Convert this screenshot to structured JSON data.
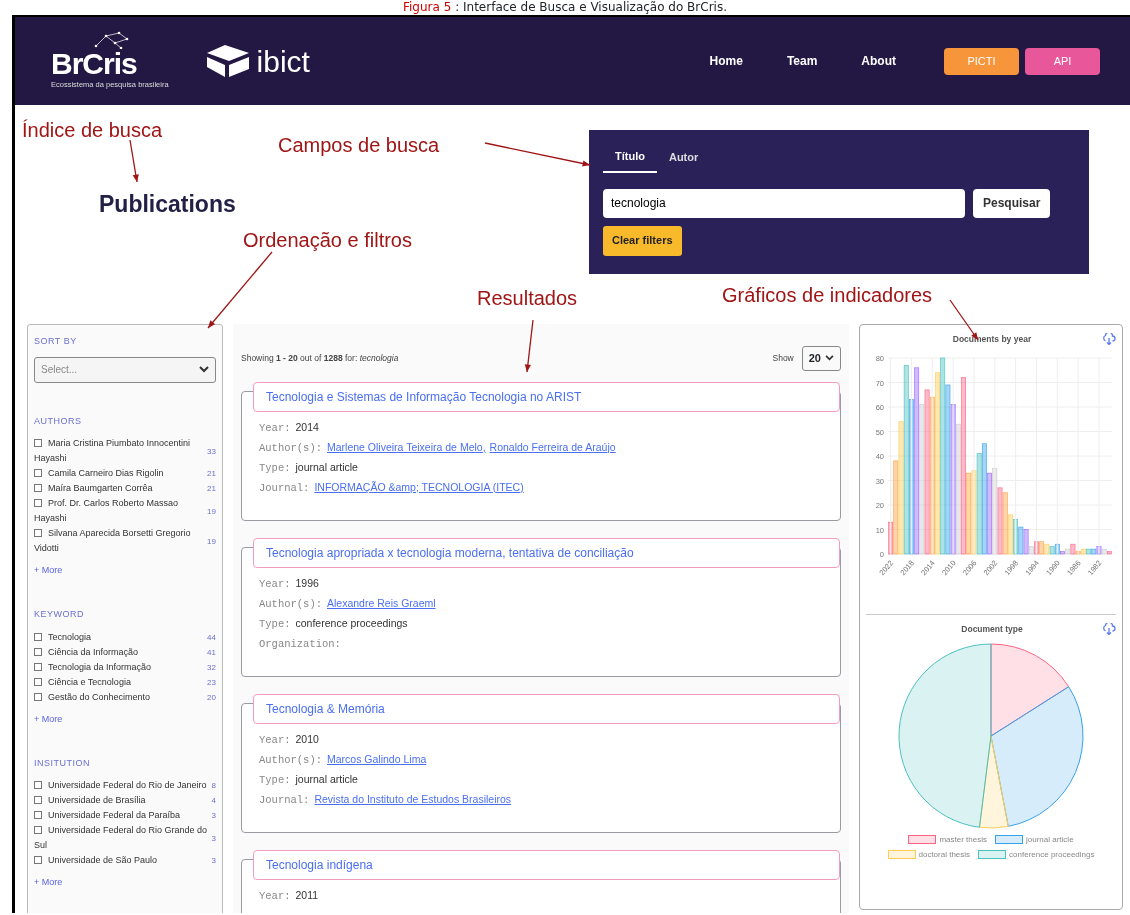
{
  "caption": {
    "label": "Figura 5",
    "text": ": Interface de Busca e Visualização do BrCris."
  },
  "navbar": {
    "logo": "BrCris",
    "logo_subtitle": "Ecossistema da pesquisa brasileira",
    "partner": "ibict",
    "links": [
      "Home",
      "Team",
      "About"
    ],
    "buttons": [
      {
        "label": "PICTI",
        "kind": "orange"
      },
      {
        "label": "API",
        "kind": "pink"
      }
    ]
  },
  "annotations": [
    "Índice de busca",
    "Campos de busca",
    "Ordenação e filtros",
    "Resultados",
    "Gráficos de indicadores"
  ],
  "heading": "Publications",
  "search": {
    "tabs": [
      {
        "label": "Título",
        "selected": true
      },
      {
        "label": "Autor",
        "selected": false
      }
    ],
    "value": "tecnologia",
    "button": "Pesquisar",
    "clear": "Clear filters"
  },
  "sidebar": {
    "sort_label": "SORT BY",
    "sort_placeholder": "Select...",
    "facets": [
      {
        "title": "AUTHORS",
        "more": "+ More",
        "items": [
          {
            "label": "Maria Cristina Piumbato Innocentini Hayashi",
            "count": "33",
            "checked": false
          },
          {
            "label": "Camila Carneiro Dias Rigolin",
            "count": "21",
            "checked": false
          },
          {
            "label": "Maíra Baumgarten Corrêa",
            "count": "21",
            "checked": false
          },
          {
            "label": "Prof. Dr. Carlos Roberto Massao Hayashi",
            "count": "19",
            "checked": false
          },
          {
            "label": "Silvana Aparecida Borsetti Gregorio Vidotti",
            "count": "19",
            "checked": false
          }
        ]
      },
      {
        "title": "KEYWORD",
        "more": "+ More",
        "items": [
          {
            "label": "Tecnologia",
            "count": "44",
            "checked": false
          },
          {
            "label": "Ciência da Informação",
            "count": "41",
            "checked": false
          },
          {
            "label": "Tecnologia da Informação",
            "count": "32",
            "checked": false
          },
          {
            "label": "Ciência e Tecnologia",
            "count": "23",
            "checked": false
          },
          {
            "label": "Gestão do Conhecimento",
            "count": "20",
            "checked": false
          }
        ]
      },
      {
        "title": "INSITUTION",
        "more": "+ More",
        "items": [
          {
            "label": "Universidade Federal do Rio de Janeiro",
            "count": "8",
            "checked": false
          },
          {
            "label": "Universidade de Brasília",
            "count": "4",
            "checked": false
          },
          {
            "label": "Universidade Federal da Paraíba",
            "count": "3",
            "checked": false
          },
          {
            "label": "Universidade Federal do Rio Grande do Sul",
            "count": "3",
            "checked": false
          },
          {
            "label": "Universidade de São Paulo",
            "count": "3",
            "checked": false
          }
        ]
      }
    ]
  },
  "results": {
    "summary": "Showing **1 - 20** out of **1288** for: *tecnologia*",
    "show_label": "Show",
    "page_size": "20",
    "items": [
      {
        "title": "Tecnologia e Sistemas de Informação Tecnologia no ARIST",
        "fields": [
          {
            "label": "Year:",
            "kind": "text",
            "value": "2014"
          },
          {
            "label": "Author(s):",
            "kind": "links",
            "links": [
              "Marlene Oliveira Teixeira de Melo,",
              "Ronaldo Ferreira de Araújo"
            ]
          },
          {
            "label": "Type:",
            "kind": "text",
            "value": "journal article"
          },
          {
            "label": "Journal:",
            "kind": "links",
            "links": [
              "INFORMAÇÃO &amp; TECNOLOGIA (ITEC)"
            ]
          }
        ]
      },
      {
        "title": "Tecnologia apropriada x tecnologia moderna, tentativa de conciliação",
        "fields": [
          {
            "label": "Year:",
            "kind": "text",
            "value": "1996"
          },
          {
            "label": "Author(s):",
            "kind": "links",
            "links": [
              "Alexandre Reis Graeml"
            ]
          },
          {
            "label": "Type:",
            "kind": "text",
            "value": "conference proceedings"
          },
          {
            "label": "Organization:",
            "kind": "empty"
          }
        ]
      },
      {
        "title": "Tecnologia & Memória",
        "fields": [
          {
            "label": "Year:",
            "kind": "text",
            "value": "2010"
          },
          {
            "label": "Author(s):",
            "kind": "links",
            "links": [
              "Marcos Galindo Lima"
            ]
          },
          {
            "label": "Type:",
            "kind": "text",
            "value": "journal article"
          },
          {
            "label": "Journal:",
            "kind": "links",
            "links": [
              "Revista do Instituto de Estudos Brasileiros"
            ]
          }
        ]
      },
      {
        "title": "Tecnologia indígena",
        "fields": [
          {
            "label": "Year:",
            "kind": "text",
            "value": "2011"
          }
        ]
      }
    ]
  },
  "charts": {
    "by_year": {
      "chart_data": {
        "type": "bar",
        "title": "Documents by year",
        "x": [
          2022,
          2021,
          2020,
          2019,
          2018,
          2017,
          2016,
          2015,
          2014,
          2013,
          2012,
          2011,
          2010,
          2009,
          2008,
          2007,
          2006,
          2005,
          2004,
          2003,
          2002,
          2001,
          2000,
          1999,
          1998,
          1997,
          1996,
          1995,
          1994,
          1993,
          1992,
          1991,
          1990,
          1989,
          1988,
          1987,
          1986,
          1985,
          1984,
          1983,
          1982,
          1981,
          1980
        ],
        "xlim": [
          2022.5,
          1979.5
        ],
        "grid": true,
        "series": [
          {
            "color": "#ff6384",
            "values": [
              13,
              null,
              null,
              null,
              null,
              null,
              null,
              67,
              null,
              null,
              null,
              null,
              null,
              null,
              72,
              null,
              null,
              null,
              null,
              null,
              null,
              27,
              null,
              null,
              null,
              null,
              null,
              null,
              5,
              null,
              null,
              null,
              null,
              null,
              null,
              4,
              null,
              null,
              null,
              null,
              null,
              null,
              1
            ]
          },
          {
            "color": "#ff9f40",
            "values": [
              null,
              38,
              null,
              null,
              null,
              null,
              null,
              null,
              64,
              null,
              null,
              null,
              null,
              null,
              null,
              33,
              null,
              null,
              null,
              null,
              null,
              null,
              25,
              null,
              null,
              null,
              null,
              null,
              null,
              5,
              null,
              null,
              null,
              null,
              null,
              null,
              1,
              null,
              null,
              null,
              null,
              null,
              null
            ]
          },
          {
            "color": "#ffcd56",
            "values": [
              null,
              null,
              54,
              null,
              null,
              null,
              null,
              null,
              null,
              74,
              null,
              null,
              null,
              null,
              null,
              null,
              34,
              null,
              null,
              null,
              null,
              null,
              null,
              16,
              null,
              null,
              null,
              null,
              null,
              null,
              4,
              null,
              null,
              null,
              null,
              null,
              null,
              2,
              null,
              null,
              null,
              null,
              null
            ]
          },
          {
            "color": "#4bc0c0",
            "values": [
              null,
              null,
              null,
              77,
              null,
              null,
              null,
              null,
              null,
              null,
              80,
              null,
              null,
              null,
              null,
              null,
              null,
              41,
              null,
              null,
              null,
              null,
              null,
              null,
              14,
              null,
              null,
              null,
              null,
              null,
              null,
              3,
              null,
              null,
              null,
              null,
              null,
              null,
              2,
              null,
              null,
              null,
              null
            ]
          },
          {
            "color": "#36a2eb",
            "values": [
              null,
              null,
              null,
              null,
              63,
              null,
              null,
              null,
              null,
              null,
              null,
              69,
              null,
              null,
              null,
              null,
              null,
              null,
              45,
              null,
              null,
              null,
              null,
              null,
              null,
              11,
              null,
              null,
              null,
              null,
              null,
              null,
              4,
              null,
              null,
              null,
              null,
              null,
              null,
              2,
              null,
              null,
              null
            ]
          },
          {
            "color": "#9966ff",
            "values": [
              null,
              null,
              null,
              null,
              null,
              76,
              null,
              null,
              null,
              null,
              null,
              null,
              61,
              null,
              null,
              null,
              null,
              null,
              null,
              33,
              null,
              null,
              null,
              null,
              null,
              null,
              10,
              null,
              null,
              null,
              null,
              null,
              null,
              1,
              null,
              null,
              null,
              null,
              null,
              null,
              3,
              null,
              null
            ]
          },
          {
            "color": "#c9cbcf",
            "values": [
              null,
              null,
              null,
              null,
              null,
              null,
              61,
              null,
              null,
              null,
              null,
              null,
              null,
              53,
              null,
              null,
              null,
              null,
              null,
              null,
              35,
              null,
              null,
              null,
              null,
              null,
              null,
              3,
              null,
              null,
              null,
              null,
              null,
              null,
              2,
              null,
              null,
              null,
              null,
              null,
              null,
              2,
              null
            ]
          }
        ],
        "ylim": [
          0,
          80
        ],
        "yticks": [
          0,
          10,
          20,
          30,
          40,
          50,
          60,
          70,
          80
        ],
        "xticks": [
          2022,
          2018,
          2014,
          2010,
          2006,
          2002,
          1998,
          1994,
          1990,
          1986,
          1982
        ]
      }
    },
    "doc_type": {
      "title": "Document type",
      "legend": [
        {
          "label": "master thesis",
          "color": "#ff6384"
        },
        {
          "label": "journal article",
          "color": "#36a2eb"
        },
        {
          "label": "doctoral thesis",
          "color": "#ffcd56"
        },
        {
          "label": "conference proceedings",
          "color": "#4bc0c0"
        }
      ]
    }
  }
}
